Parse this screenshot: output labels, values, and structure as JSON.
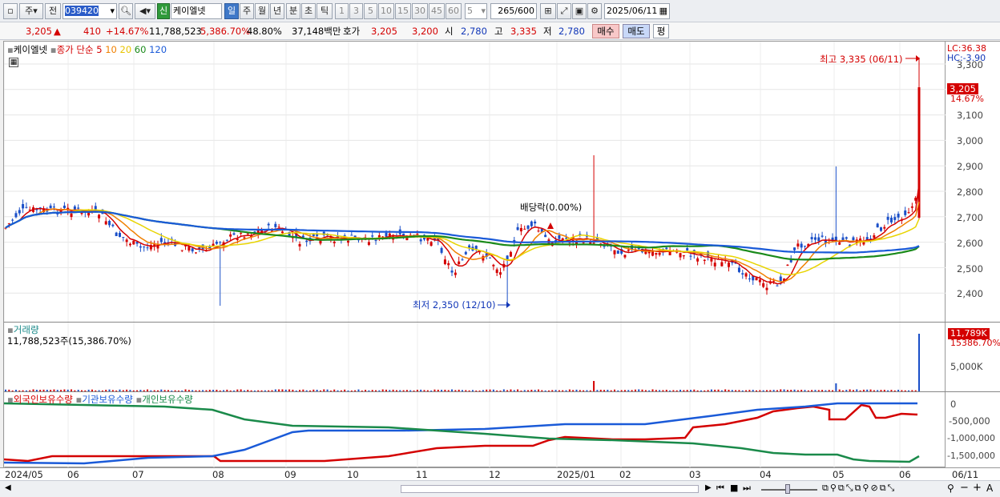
{
  "toolbar": {
    "type_label": "주",
    "prev_label": "전",
    "code": "039420",
    "shin_label": "신",
    "stock_name": "케이엘넷",
    "periods": [
      "일",
      "주",
      "월",
      "년",
      "분",
      "초",
      "틱"
    ],
    "minute_presets": [
      "1",
      "3",
      "5",
      "10",
      "15",
      "30",
      "45",
      "60"
    ],
    "count_value": "5",
    "bar_count": "265",
    "bar_max": "/600",
    "date": "2025/06/11"
  },
  "quote": {
    "price": "3,205",
    "up_mark": "▲",
    "change": "410",
    "change_pct": "+14.67%",
    "volume": "11,788,523",
    "volume_ratio": "5,386.70%",
    "rotation": "48.80%",
    "amount": "37,148백만",
    "hoga_label": "호가",
    "ask": "3,205",
    "bid": "3,200",
    "open_label": "시",
    "open": "2,780",
    "high_label": "고",
    "high": "3,335",
    "low_label": "저",
    "low": "2,780",
    "buy_label": "매수",
    "sell_label": "매도",
    "eval_label": "평"
  },
  "price_panel": {
    "legend_name": "케이엘넷",
    "legend_main": "종가 단순",
    "ma_periods": [
      "5",
      "10",
      "20",
      "60",
      "120"
    ],
    "ma_colors": [
      "#d40000",
      "#f08000",
      "#e8d400",
      "#1a8a1a",
      "#1a5ad8"
    ],
    "lc": "LC:36.38",
    "hc": "HC:-3.90",
    "current_price": "3,205",
    "current_pct": "14.67%",
    "high_marker": "최고 3,335 (06/11)",
    "low_marker": "최저 2,350 (12/10)",
    "dividend_marker": "배당락(0.00%)",
    "y_ticks": [
      "3,300",
      "3,200",
      "3,100",
      "3,000",
      "2,900",
      "2,800",
      "2,700",
      "2,600",
      "2,500",
      "2,400"
    ]
  },
  "volume_panel": {
    "title": "거래량",
    "info": "11,788,523주(15,386.70%)",
    "current": "11,789K",
    "current_pct": "15386.70%",
    "tick": "5,000K"
  },
  "holding_panel": {
    "legend": [
      "외국인보유수량",
      "기관보유수량",
      "개인보유수량"
    ],
    "colors": [
      "#d40000",
      "#1a5ad8",
      "#1a8a4a"
    ],
    "y_ticks": [
      "0",
      "-500,000",
      "-1,000,000",
      "-1,500,000"
    ]
  },
  "x_axis": {
    "labels": [
      "2024/05",
      "06",
      "07",
      "08",
      "09",
      "10",
      "11",
      "12",
      "2025/01",
      "02",
      "03",
      "04",
      "05",
      "06"
    ],
    "end_label": "06/11"
  }
}
